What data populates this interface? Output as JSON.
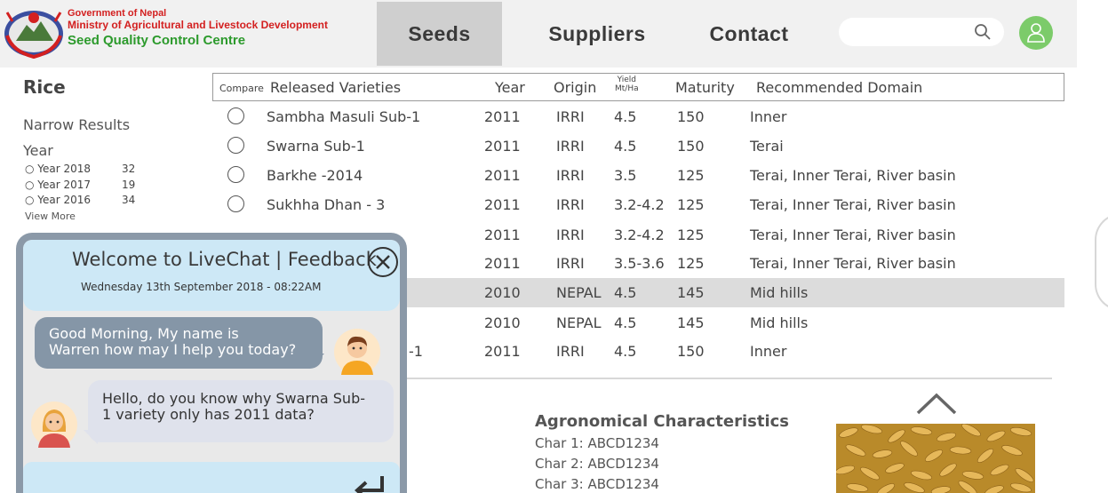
{
  "header": {
    "org_line1": "Government of Nepal",
    "org_line2": "Ministry of Agricultural and Livestock Development",
    "org_line3": "Seed Quality Control Centre",
    "nav": [
      "Seeds",
      "Suppliers",
      "Contact"
    ],
    "active_tab": "Seeds",
    "search_placeholder": "",
    "icons": [
      "emblem-logo",
      "search-icon",
      "user-avatar-icon"
    ]
  },
  "filters": {
    "category": "Rice",
    "narrow_label": "Narrow Results",
    "year_label": "Year",
    "options": [
      {
        "label": "Year 2018",
        "count": "32"
      },
      {
        "label": "Year 2017",
        "count": "19"
      },
      {
        "label": "Year 2016",
        "count": "34"
      }
    ],
    "view_more": "View More"
  },
  "table": {
    "headers": {
      "compare": "Compare",
      "variety": "Released Varieties",
      "year": "Year",
      "origin": "Origin",
      "yield_l1": "Yield",
      "yield_l2": "Mt/Ha",
      "maturity": "Maturity",
      "domain": "Recommended Domain"
    },
    "rows": [
      {
        "variety": "Sambha Masuli Sub-1",
        "year": "2011",
        "origin": "IRRI",
        "yield": "4.5",
        "maturity": "150",
        "domain": "Inner"
      },
      {
        "variety": "Swarna Sub-1",
        "year": "2011",
        "origin": "IRRI",
        "yield": "4.5",
        "maturity": "150",
        "domain": "Terai"
      },
      {
        "variety": "Barkhe -2014",
        "year": "2011",
        "origin": "IRRI",
        "yield": "3.5",
        "maturity": "125",
        "domain": "Terai, Inner Terai, River basin"
      },
      {
        "variety": "Sukhha Dhan - 3",
        "year": "2011",
        "origin": "IRRI",
        "yield": "3.2-4.2",
        "maturity": "125",
        "domain": "Terai, Inner Terai, River basin"
      },
      {
        "variety": "",
        "year": "2011",
        "origin": "IRRI",
        "yield": "3.2-4.2",
        "maturity": "125",
        "domain": "Terai, Inner Terai, River basin"
      },
      {
        "variety": "",
        "year": "2011",
        "origin": "IRRI",
        "yield": "3.5-3.6",
        "maturity": "125",
        "domain": "Terai, Inner Terai, River basin"
      },
      {
        "variety": "",
        "year": "2010",
        "origin": "NEPAL",
        "yield": "4.5",
        "maturity": "145",
        "domain": "Mid hills"
      },
      {
        "variety": "",
        "year": "2010",
        "origin": "NEPAL",
        "yield": "4.5",
        "maturity": "145",
        "domain": "Mid hills"
      },
      {
        "variety": "-1",
        "year": "2011",
        "origin": "IRRI",
        "yield": "4.5",
        "maturity": "150",
        "domain": "Inner"
      }
    ],
    "highlighted_row": 6
  },
  "details": {
    "title": "Agronomical Characteristics",
    "chars": [
      "Char 1: ABCD1234",
      "Char 2: ABCD1234",
      "Char 3: ABCD1234"
    ]
  },
  "chat": {
    "title": "Welcome to LiveChat | Feedback",
    "date": "Wednesday 13th September 2018 - 08:22AM",
    "agent_line1": "Good Morning, My name is",
    "agent_line2": "Warren how may I help you today?",
    "user_line1": "Hello, do you know why Swarna Sub-",
    "user_line2": "1 variety only has 2011 data?"
  },
  "colors": {
    "header_bg": "#f1f1f1",
    "active_tab_bg": "#cfcfcf",
    "org_red": "#d32020",
    "org_green": "#2c9a2c",
    "avatar_green": "#7ccb6a",
    "chat_blue": "#cde8f6",
    "agent_bubble": "#8596a7",
    "user_bubble": "#dfe2ec"
  }
}
